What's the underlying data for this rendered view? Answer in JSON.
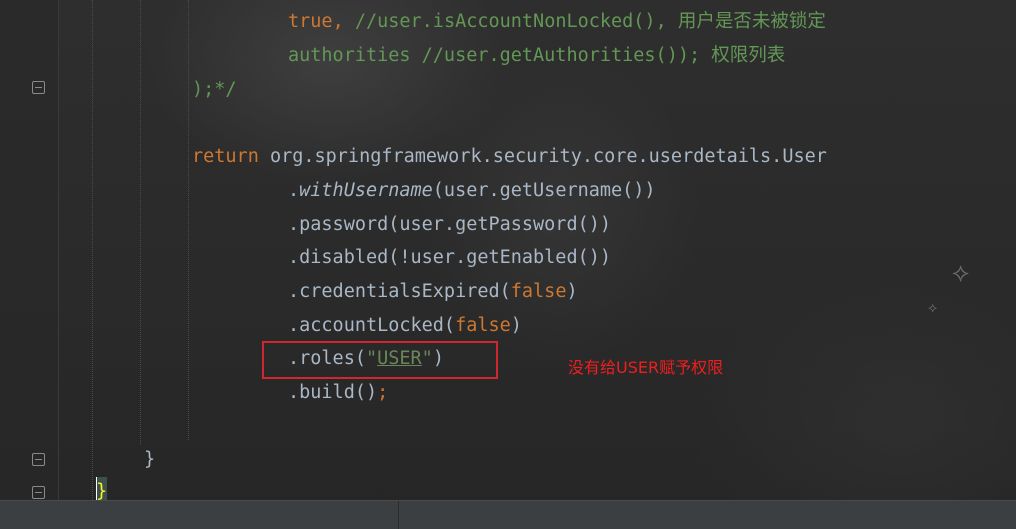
{
  "editor": {
    "lines": [
      {
        "id": "l1",
        "tokens": [
          {
            "t": "true",
            "c": "kw"
          },
          {
            "t": ", ",
            "c": "kw"
          },
          {
            "t": "//user.isAccountNonLocked(), 用户是否未被锁定",
            "c": "cm"
          }
        ]
      },
      {
        "id": "l2",
        "tokens": [
          {
            "t": "authorities ",
            "c": "cm"
          },
          {
            "t": "//user.getAuthorities()); 权限列表",
            "c": "cm"
          }
        ]
      },
      {
        "id": "l3",
        "tokens": [
          {
            "t": ");*/",
            "c": "cm"
          }
        ]
      },
      {
        "id": "l4",
        "tokens": []
      },
      {
        "id": "l5",
        "tokens": [
          {
            "t": "return ",
            "c": "kw"
          },
          {
            "t": "org.springframework.security.core.userdetails.User",
            "c": ""
          }
        ]
      },
      {
        "id": "l6",
        "tokens": [
          {
            "t": ".",
            "c": ""
          },
          {
            "t": "withUsername",
            "c": "it"
          },
          {
            "t": "(user.getUsername())",
            "c": ""
          }
        ]
      },
      {
        "id": "l7",
        "tokens": [
          {
            "t": ".password(user.getPassword())",
            "c": ""
          }
        ]
      },
      {
        "id": "l8",
        "tokens": [
          {
            "t": ".disabled(!user.getEnabled())",
            "c": ""
          }
        ]
      },
      {
        "id": "l9",
        "tokens": [
          {
            "t": ".credentialsExpired(",
            "c": ""
          },
          {
            "t": "false",
            "c": "kw"
          },
          {
            "t": ")",
            "c": ""
          }
        ]
      },
      {
        "id": "l10",
        "tokens": [
          {
            "t": ".accountLocked(",
            "c": ""
          },
          {
            "t": "false",
            "c": "kw"
          },
          {
            "t": ")",
            "c": ""
          }
        ]
      },
      {
        "id": "l11",
        "tokens": [
          {
            "t": ".roles(",
            "c": ""
          },
          {
            "t": "\"",
            "c": "str-q"
          },
          {
            "t": "USER",
            "c": "str"
          },
          {
            "t": "\"",
            "c": "str-q"
          },
          {
            "t": ")",
            "c": ""
          }
        ]
      },
      {
        "id": "l12",
        "tokens": [
          {
            "t": ".build()",
            "c": ""
          },
          {
            "t": ";",
            "c": "kw"
          }
        ]
      },
      {
        "id": "l13",
        "tokens": []
      },
      {
        "id": "l14",
        "tokens": [
          {
            "t": "}",
            "c": ""
          }
        ]
      },
      {
        "id": "l15",
        "tokens": [
          {
            "t": "}",
            "c": "caret"
          }
        ]
      }
    ]
  },
  "annotation": {
    "text": "没有给USER赋予权限",
    "color": "#f01e1e",
    "box_color": "#d0262e"
  },
  "colors": {
    "keyword": "#cc7832",
    "comment": "#629755",
    "string": "#6a8759",
    "default": "#a9b7c6"
  }
}
